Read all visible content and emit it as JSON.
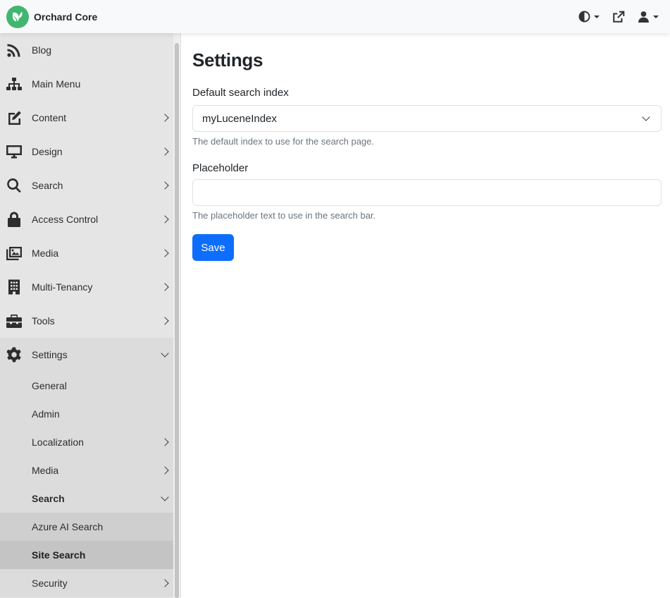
{
  "app": {
    "brand": "Orchard Core",
    "accent_color": "#0d6efd",
    "logo_color": "#41b670"
  },
  "topbar": {
    "icons": [
      "theme-toggle-icon",
      "external-link-icon",
      "user-icon"
    ]
  },
  "sidebar": {
    "items": [
      {
        "label": "Blog",
        "icon": "rss-icon"
      },
      {
        "label": "Main Menu",
        "icon": "sitemap-icon"
      },
      {
        "label": "Content",
        "icon": "edit-icon"
      },
      {
        "label": "Design",
        "icon": "monitor-icon"
      },
      {
        "label": "Search",
        "icon": "search-icon"
      },
      {
        "label": "Access Control",
        "icon": "lock-icon"
      },
      {
        "label": "Media",
        "icon": "images-icon"
      },
      {
        "label": "Multi-Tenancy",
        "icon": "building-icon"
      },
      {
        "label": "Tools",
        "icon": "toolbox-icon"
      },
      {
        "label": "Settings",
        "icon": "gear-icon"
      }
    ],
    "settings_children": [
      {
        "label": "General"
      },
      {
        "label": "Admin"
      },
      {
        "label": "Localization"
      },
      {
        "label": "Media"
      },
      {
        "label": "Search"
      },
      {
        "label": "Security"
      }
    ],
    "search_children": [
      {
        "label": "Azure AI Search"
      },
      {
        "label": "Site Search"
      }
    ]
  },
  "main": {
    "title": "Settings",
    "default_index_label": "Default search index",
    "default_index_value": "myLuceneIndex",
    "default_index_help": "The default index to use for the search page.",
    "placeholder_label": "Placeholder",
    "placeholder_value": "",
    "placeholder_help": "The placeholder text to use in the search bar.",
    "save_label": "Save"
  }
}
